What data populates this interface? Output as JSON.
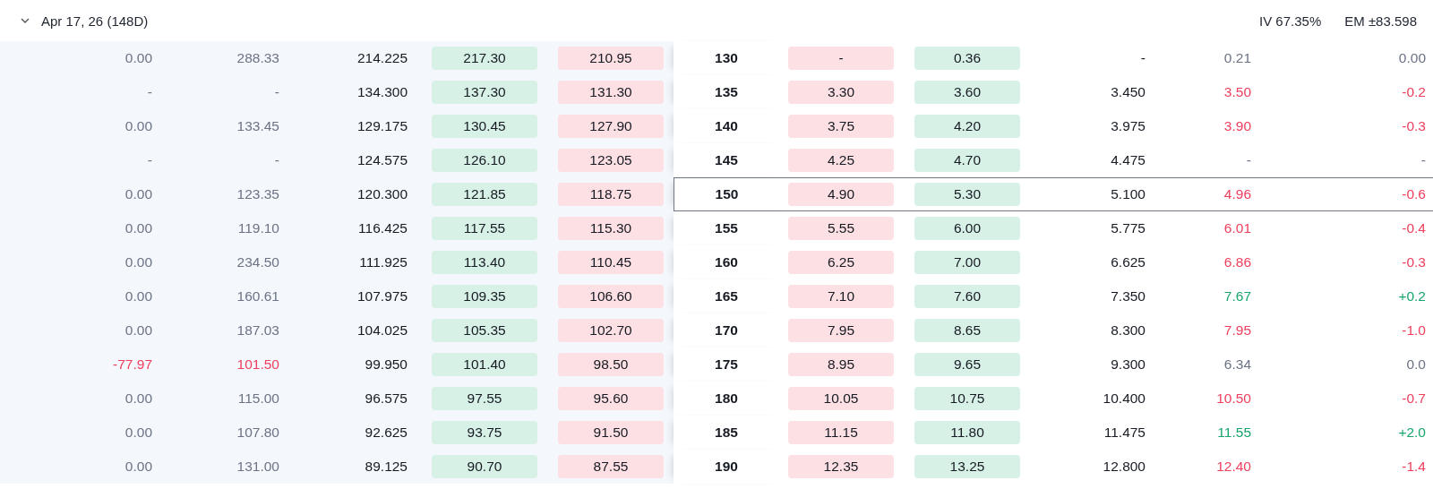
{
  "header": {
    "expiry": "Apr 17, 26 (148D)",
    "expanded": true,
    "iv": "IV 67.35%",
    "em": "EM ±83.598"
  },
  "rows": [
    {
      "strike": "130",
      "atm": false,
      "call": {
        "color": "#6b7384",
        "change": "0.00",
        "last": "288.33",
        "mark": "214.225",
        "bid": "217.30",
        "ask": "210.95"
      },
      "put": {
        "color": "#6b7384",
        "bid": "-",
        "ask": "0.36",
        "mark": "-",
        "last": "0.21",
        "change": "0.00"
      }
    },
    {
      "strike": "135",
      "atm": false,
      "call": {
        "color": "#6b7384",
        "change": "-",
        "last": "-",
        "mark": "134.300",
        "bid": "137.30",
        "ask": "131.30"
      },
      "put": {
        "color": "#ef3f5c",
        "bid": "3.30",
        "ask": "3.60",
        "mark": "3.450",
        "last": "3.50",
        "change": "-0.2"
      }
    },
    {
      "strike": "140",
      "atm": false,
      "call": {
        "color": "#6b7384",
        "change": "0.00",
        "last": "133.45",
        "mark": "129.175",
        "bid": "130.45",
        "ask": "127.90"
      },
      "put": {
        "color": "#ef3f5c",
        "bid": "3.75",
        "ask": "4.20",
        "mark": "3.975",
        "last": "3.90",
        "change": "-0.3"
      }
    },
    {
      "strike": "145",
      "atm": false,
      "call": {
        "color": "#6b7384",
        "change": "-",
        "last": "-",
        "mark": "124.575",
        "bid": "126.10",
        "ask": "123.05"
      },
      "put": {
        "color": "#6b7384",
        "bid": "4.25",
        "ask": "4.70",
        "mark": "4.475",
        "last": "-",
        "change": "-"
      }
    },
    {
      "strike": "150",
      "atm": true,
      "call": {
        "color": "#6b7384",
        "change": "0.00",
        "last": "123.35",
        "mark": "120.300",
        "bid": "121.85",
        "ask": "118.75"
      },
      "put": {
        "color": "#ef3f5c",
        "bid": "4.90",
        "ask": "5.30",
        "mark": "5.100",
        "last": "4.96",
        "change": "-0.6"
      }
    },
    {
      "strike": "155",
      "atm": false,
      "call": {
        "color": "#6b7384",
        "change": "0.00",
        "last": "119.10",
        "mark": "116.425",
        "bid": "117.55",
        "ask": "115.30"
      },
      "put": {
        "color": "#ef3f5c",
        "bid": "5.55",
        "ask": "6.00",
        "mark": "5.775",
        "last": "6.01",
        "change": "-0.4"
      }
    },
    {
      "strike": "160",
      "atm": false,
      "call": {
        "color": "#6b7384",
        "change": "0.00",
        "last": "234.50",
        "mark": "111.925",
        "bid": "113.40",
        "ask": "110.45"
      },
      "put": {
        "color": "#ef3f5c",
        "bid": "6.25",
        "ask": "7.00",
        "mark": "6.625",
        "last": "6.86",
        "change": "-0.3"
      }
    },
    {
      "strike": "165",
      "atm": false,
      "call": {
        "color": "#6b7384",
        "change": "0.00",
        "last": "160.61",
        "mark": "107.975",
        "bid": "109.35",
        "ask": "106.60"
      },
      "put": {
        "color": "#17a56c",
        "bid": "7.10",
        "ask": "7.60",
        "mark": "7.350",
        "last": "7.67",
        "change": "+0.2"
      }
    },
    {
      "strike": "170",
      "atm": false,
      "call": {
        "color": "#6b7384",
        "change": "0.00",
        "last": "187.03",
        "mark": "104.025",
        "bid": "105.35",
        "ask": "102.70"
      },
      "put": {
        "color": "#ef3f5c",
        "bid": "7.95",
        "ask": "8.65",
        "mark": "8.300",
        "last": "7.95",
        "change": "-1.0"
      }
    },
    {
      "strike": "175",
      "atm": false,
      "call": {
        "color": "#ef3f5c",
        "change": "-77.97",
        "last": "101.50",
        "mark": "99.950",
        "bid": "101.40",
        "ask": "98.50"
      },
      "put": {
        "color": "#6b7384",
        "bid": "8.95",
        "ask": "9.65",
        "mark": "9.300",
        "last": "6.34",
        "change": "0.0"
      }
    },
    {
      "strike": "180",
      "atm": false,
      "call": {
        "color": "#6b7384",
        "change": "0.00",
        "last": "115.00",
        "mark": "96.575",
        "bid": "97.55",
        "ask": "95.60"
      },
      "put": {
        "color": "#ef3f5c",
        "bid": "10.05",
        "ask": "10.75",
        "mark": "10.400",
        "last": "10.50",
        "change": "-0.7"
      }
    },
    {
      "strike": "185",
      "atm": false,
      "call": {
        "color": "#6b7384",
        "change": "0.00",
        "last": "107.80",
        "mark": "92.625",
        "bid": "93.75",
        "ask": "91.50"
      },
      "put": {
        "color": "#17a56c",
        "bid": "11.15",
        "ask": "11.80",
        "mark": "11.475",
        "last": "11.55",
        "change": "+2.0"
      }
    },
    {
      "strike": "190",
      "atm": false,
      "call": {
        "color": "#6b7384",
        "change": "0.00",
        "last": "131.00",
        "mark": "89.125",
        "bid": "90.70",
        "ask": "87.55"
      },
      "put": {
        "color": "#ef3f5c",
        "bid": "12.35",
        "ask": "13.25",
        "mark": "12.800",
        "last": "12.40",
        "change": "-1.4"
      }
    }
  ]
}
